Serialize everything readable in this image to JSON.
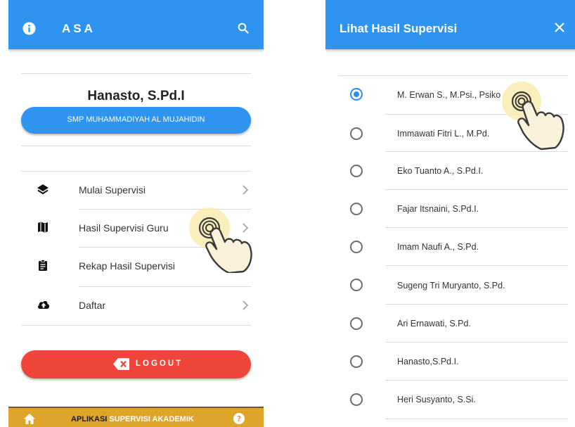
{
  "left_screen": {
    "appbar": {
      "title": "ASA",
      "info_icon": "info-icon",
      "search_icon": "search-icon"
    },
    "profile": {
      "name": "Hanasto, S.Pd.I",
      "school_button": "SMP MUHAMMADIYAH AL MUJAHIDIN"
    },
    "menu": [
      {
        "label": "Mulai Supervisi",
        "icon": "layers-icon"
      },
      {
        "label": "Hasil Supervisi Guru",
        "icon": "map-icon"
      },
      {
        "label": "Rekap Hasil Supervisi",
        "icon": "clipboard-icon"
      },
      {
        "label": "Daftar",
        "icon": "cloud-upload-icon"
      }
    ],
    "logout_label": "LOGOUT",
    "bottom_bar": {
      "part1": "APLIKASI",
      "part2": "SUPERVISI AKADEMIK"
    },
    "colors": {
      "primary": "#2f93f0",
      "logout": "#f0453a",
      "bottom": "#dfa52a"
    }
  },
  "right_screen": {
    "title": "Lihat Hasil Supervisi",
    "close_icon": "close-icon",
    "options": [
      {
        "label": "M. Erwan S., M.Psi., Psiko",
        "selected": true
      },
      {
        "label": "Immawati Fitri L., M.Pd.",
        "selected": false
      },
      {
        "label": "Eko Tuanto A., S.Pd.I.",
        "selected": false
      },
      {
        "label": "Fajar Itsnaini, S.Pd.I.",
        "selected": false
      },
      {
        "label": "Imam Naufi A., S.Pd.",
        "selected": false
      },
      {
        "label": "Sugeng Tri Muryanto, S.Pd.",
        "selected": false
      },
      {
        "label": "Ari Ernawati, S.Pd.",
        "selected": false
      },
      {
        "label": "Hanasto,S.Pd.I.",
        "selected": false
      },
      {
        "label": "Heri Susyanto, S.Si.",
        "selected": false
      }
    ]
  }
}
